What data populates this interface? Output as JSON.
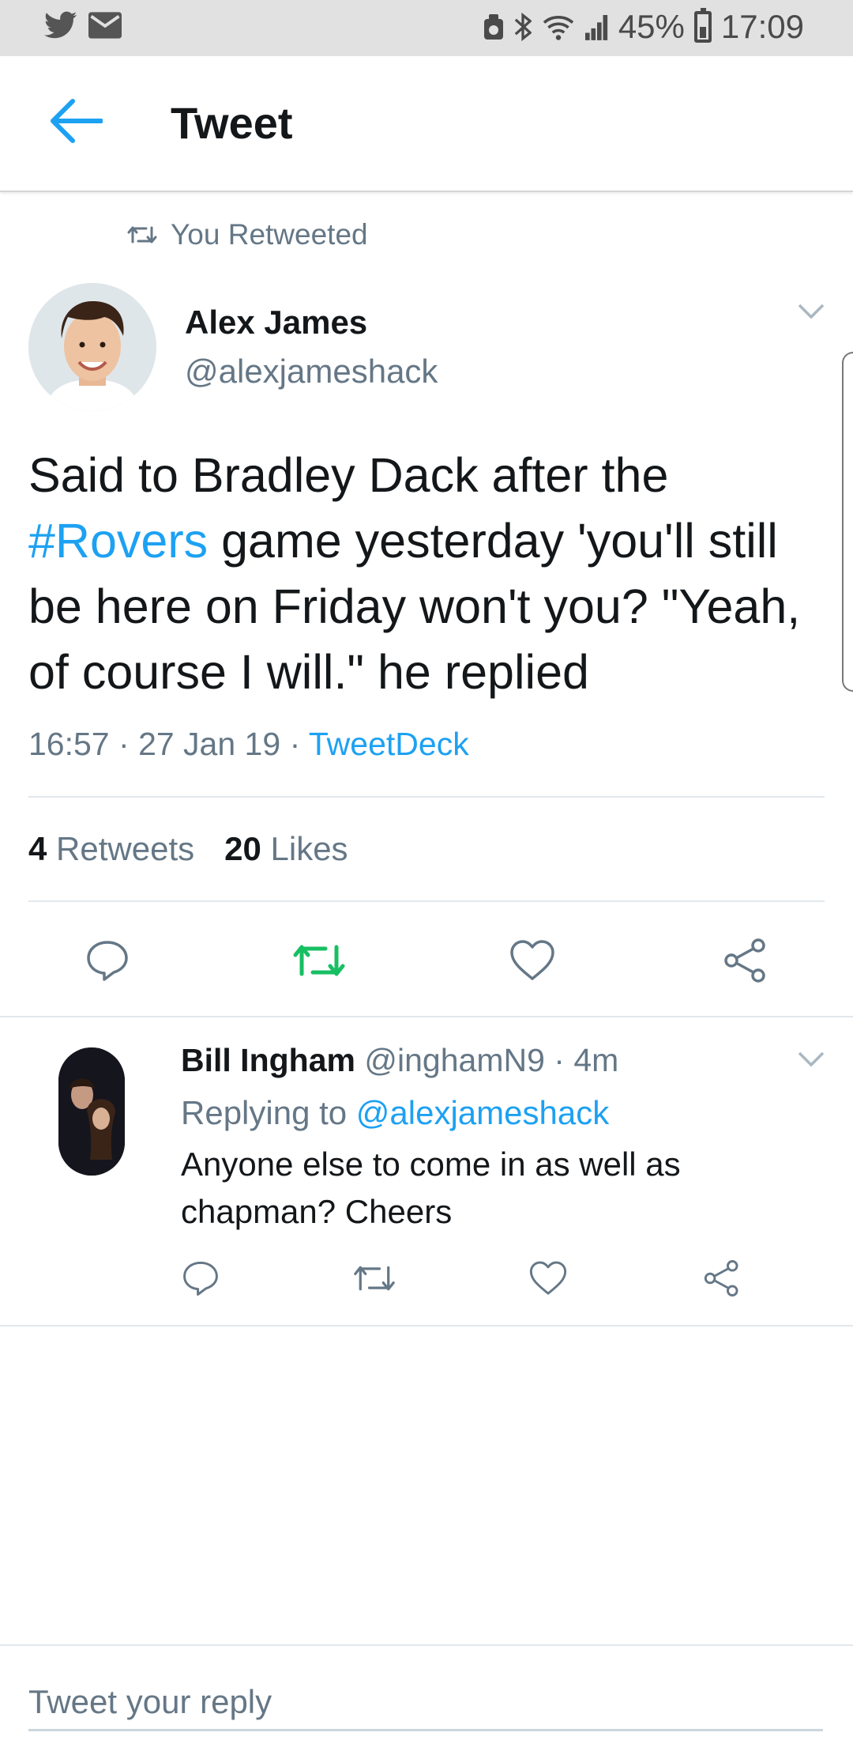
{
  "status_bar": {
    "battery": "45%",
    "time": "17:09"
  },
  "header": {
    "title": "Tweet"
  },
  "retweet_context": {
    "label": "You Retweeted"
  },
  "tweet": {
    "author_name": "Alex James",
    "author_handle": "@alexjameshack",
    "text_part1": "Said to Bradley Dack after the ",
    "hashtag": "#Rovers",
    "text_part2": " game yesterday 'you'll still be here on Friday won't you? \"Yeah, of course I will.\"  he replied",
    "time": "16:57",
    "date": "27 Jan 19",
    "source": "TweetDeck",
    "retweet_count": "4",
    "retweet_label": "Retweets",
    "like_count": "20",
    "like_label": "Likes"
  },
  "reply": {
    "author_name": "Bill Ingham",
    "author_handle": "@inghamN9",
    "age": "4m",
    "replying_label": "Replying to",
    "replying_to": "@alexjameshack",
    "text": "Anyone else to come in as well as chapman? Cheers"
  },
  "compose": {
    "placeholder": "Tweet your reply"
  },
  "colors": {
    "accent": "#1da1f2",
    "retweet_active": "#17bf63",
    "secondary_text": "#657786"
  }
}
